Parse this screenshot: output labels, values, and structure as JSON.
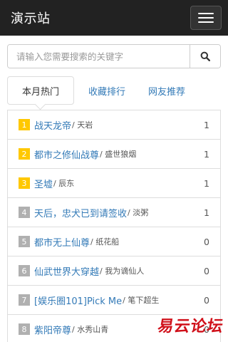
{
  "navbar": {
    "brand": "演示站",
    "menu_icon": "hamburger-icon"
  },
  "search": {
    "placeholder": "请输入您需要搜索的关键字",
    "icon": "search-icon"
  },
  "tabs": [
    {
      "label": "本月热门",
      "active": true
    },
    {
      "label": "收藏排行",
      "active": false
    },
    {
      "label": "网友推荐",
      "active": false
    }
  ],
  "list": [
    {
      "rank": "1",
      "title": "战天龙帝",
      "author": "/ 天岩",
      "count": "1"
    },
    {
      "rank": "2",
      "title": "都市之修仙战尊",
      "author": "/ 盛世狼烟",
      "count": "1"
    },
    {
      "rank": "3",
      "title": "圣墟",
      "author": "/ 辰东",
      "count": "1"
    },
    {
      "rank": "4",
      "title": "天后，忠犬已到请签收",
      "author": "/ 淡粥",
      "count": "1"
    },
    {
      "rank": "5",
      "title": "都市无上仙尊",
      "author": "/ 纸花船",
      "count": "0"
    },
    {
      "rank": "6",
      "title": "仙武世界大穿越",
      "author": "/ 我为谪仙人",
      "count": "0"
    },
    {
      "rank": "7",
      "title": "[娱乐圈101]Pick Me",
      "author": "/ 笔下超生",
      "count": "0"
    },
    {
      "rank": "8",
      "title": "紫阳帝尊",
      "author": "/ 水秀山青",
      "count": "0"
    }
  ],
  "watermark": "易云论坛",
  "colors": {
    "navbar": "#222222",
    "link": "#337ab7",
    "rank_top": "#ffc800",
    "rank_rest": "#b0b0b0",
    "watermark": "#d0101a"
  }
}
